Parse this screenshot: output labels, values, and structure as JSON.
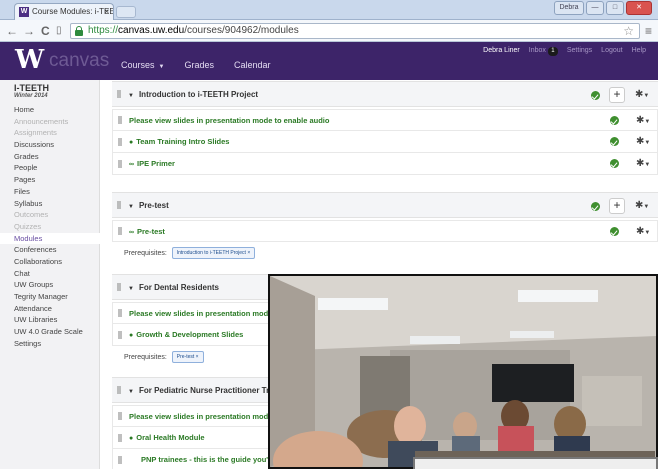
{
  "browser": {
    "tab_title": "Course Modules: i-TEETH",
    "tab_favicon": "W",
    "close_glyph": "×",
    "url_scheme": "https://",
    "url_host": "canvas.uw.edu",
    "url_path": "/courses/904962/modules",
    "window_user": "Debra"
  },
  "header": {
    "logo_mark": "W",
    "logo_text": "canvas",
    "nav": [
      {
        "label": "Courses"
      },
      {
        "label": "Grades"
      },
      {
        "label": "Calendar"
      }
    ],
    "user_name": "Debra Liner",
    "inbox_label": "Inbox",
    "inbox_count": "1",
    "settings_label": "Settings",
    "logout_label": "Logout",
    "help_label": "Help"
  },
  "sidebar": {
    "course_title": "I-TEETH",
    "course_term": "Winter 2014",
    "items": [
      {
        "label": "Home",
        "state": "normal"
      },
      {
        "label": "Announcements",
        "state": "dim"
      },
      {
        "label": "Assignments",
        "state": "dim"
      },
      {
        "label": "Discussions",
        "state": "normal"
      },
      {
        "label": "Grades",
        "state": "normal"
      },
      {
        "label": "People",
        "state": "normal"
      },
      {
        "label": "Pages",
        "state": "normal"
      },
      {
        "label": "Files",
        "state": "normal"
      },
      {
        "label": "Syllabus",
        "state": "normal"
      },
      {
        "label": "Outcomes",
        "state": "dim"
      },
      {
        "label": "Quizzes",
        "state": "dim"
      },
      {
        "label": "Modules",
        "state": "active"
      },
      {
        "label": "Conferences",
        "state": "normal"
      },
      {
        "label": "Collaborations",
        "state": "normal"
      },
      {
        "label": "Chat",
        "state": "normal"
      },
      {
        "label": "UW Groups",
        "state": "normal"
      },
      {
        "label": "Tegrity Manager",
        "state": "normal"
      },
      {
        "label": "Attendance",
        "state": "normal"
      },
      {
        "label": "UW Libraries",
        "state": "normal"
      },
      {
        "label": "UW 4.0 Grade Scale",
        "state": "normal"
      },
      {
        "label": "Settings",
        "state": "normal"
      }
    ]
  },
  "modules": {
    "prerequisites_label": "Prerequisites:",
    "m1": {
      "title": "Introduction to i-TEETH Project",
      "items": [
        "Please view slides in presentation mode to enable audio",
        "Team Training Intro Slides",
        "IPE Primer"
      ]
    },
    "m2": {
      "title": "Pre-test",
      "items": [
        "Pre-test"
      ],
      "prereq_pill": "Introduction to i-TEETH Project ×"
    },
    "m3": {
      "title": "For Dental Residents",
      "items": [
        "Please view slides in presentation mode to",
        "Growth & Development Slides"
      ],
      "prereq_pill": "Pre-test ×"
    },
    "m4": {
      "title": "For Pediatric Nurse Practitioner Trai",
      "items": [
        "Please view slides in presentation mode to",
        "Oral Health Module",
        "PNP trainees - this is the guide you'll n"
      ]
    }
  }
}
